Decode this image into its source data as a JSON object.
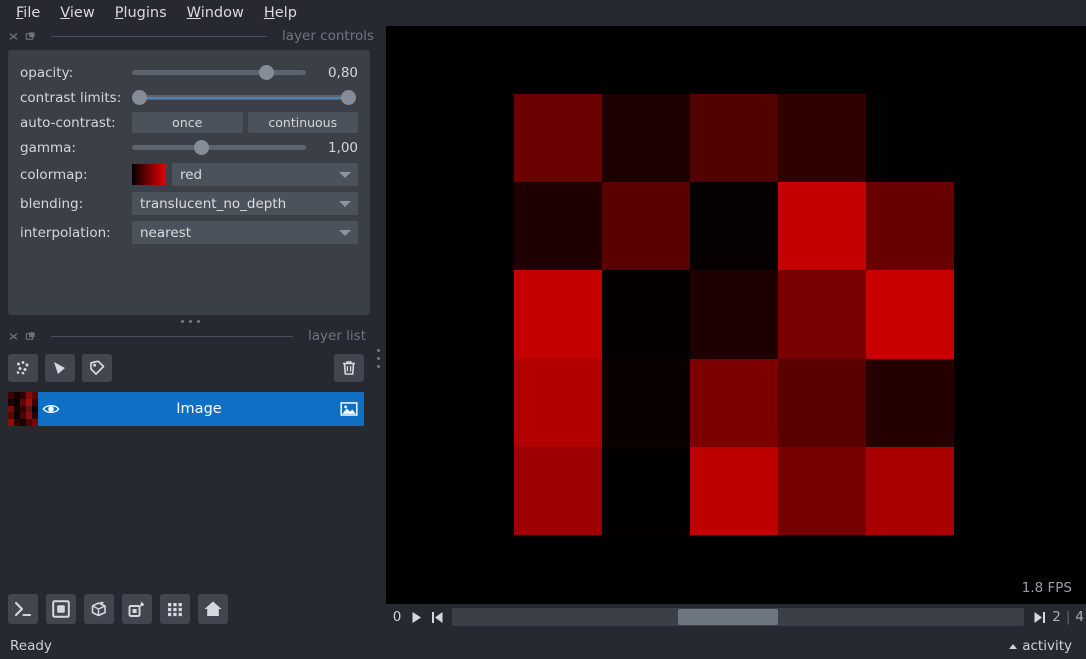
{
  "menubar": {
    "items": [
      {
        "mnemonic": "F",
        "rest": "ile",
        "name": "file"
      },
      {
        "mnemonic": "V",
        "rest": "iew",
        "name": "view"
      },
      {
        "mnemonic": "P",
        "rest": "lugins",
        "name": "plugins"
      },
      {
        "mnemonic": "W",
        "rest": "indow",
        "name": "window"
      },
      {
        "mnemonic": "H",
        "rest": "elp",
        "name": "help"
      }
    ]
  },
  "layer_controls": {
    "panel_title": "layer controls",
    "opacity": {
      "label": "opacity:",
      "value": "0,80",
      "percent": 80
    },
    "contrast_limits": {
      "label": "contrast limits:",
      "low_percent": 0,
      "high_percent": 100
    },
    "auto_contrast": {
      "label": "auto-contrast:",
      "once": "once",
      "continuous": "continuous"
    },
    "gamma": {
      "label": "gamma:",
      "value": "1,00",
      "percent": 39
    },
    "colormap": {
      "label": "colormap:",
      "value": "red"
    },
    "blending": {
      "label": "blending:",
      "value": "translucent_no_depth"
    },
    "interpolation": {
      "label": "interpolation:",
      "value": "nearest"
    }
  },
  "layer_list": {
    "panel_title": "layer list",
    "buttons": [
      {
        "name": "new-points-layer-button",
        "icon": "points-icon"
      },
      {
        "name": "new-shapes-layer-button",
        "icon": "shapes-icon"
      },
      {
        "name": "new-labels-layer-button",
        "icon": "labels-tag-icon"
      }
    ],
    "delete_button": {
      "name": "delete-layer-button",
      "icon": "trash-icon"
    },
    "layers": [
      {
        "name": "Image",
        "visible": true,
        "selected": true,
        "type_icon": "image-icon"
      }
    ],
    "thumbnail_colors": [
      "#3d0404",
      "#140202",
      "#2b0000",
      "#8a0b0b",
      "#5c0505",
      "#1d0202",
      "#0a0000",
      "#5e0707",
      "#9c0f0f",
      "#3a0404",
      "#7a0808",
      "#160101",
      "#330303",
      "#661010",
      "#120101",
      "#5a0606",
      "#0d0000",
      "#480505",
      "#8b0e0e",
      "#2a0202",
      "#8f0d0d",
      "#2b0303",
      "#120101",
      "#4a0505",
      "#740909"
    ]
  },
  "viewer_buttons": [
    {
      "name": "console-button",
      "icon": "console-icon"
    },
    {
      "name": "toggle-ndisplay-button",
      "icon": "square-2d-icon"
    },
    {
      "name": "roll-dims-button",
      "icon": "cube-roll-icon"
    },
    {
      "name": "transpose-dims-button",
      "icon": "transpose-icon"
    },
    {
      "name": "grid-view-button",
      "icon": "grid-icon"
    },
    {
      "name": "reset-view-button",
      "icon": "home-icon"
    }
  ],
  "canvas": {
    "fps": "1.8 FPS",
    "image_pixels": [
      [
        "#6b0000",
        "#1e0000",
        "#520000",
        "#310000",
        "#020000"
      ],
      [
        "#1f0000",
        "#5a0000",
        "#070000",
        "#c40000",
        "#690000"
      ],
      [
        "#c50000",
        "#040000",
        "#1d0000",
        "#780000",
        "#c70000"
      ],
      [
        "#b20000",
        "#0b0000",
        "#7c0000",
        "#590000",
        "#240000"
      ],
      [
        "#9c0000",
        "#030000",
        "#bd0000",
        "#760000",
        "#a80000"
      ]
    ]
  },
  "dims": {
    "axis_label": "0",
    "play_button": "play-icon",
    "prev_button": "step-back-icon",
    "next_button": "step-forward-icon",
    "current_value": "2",
    "separator": "|",
    "max_value": "4"
  },
  "statusbar": {
    "status": "Ready",
    "activity": "activity"
  }
}
